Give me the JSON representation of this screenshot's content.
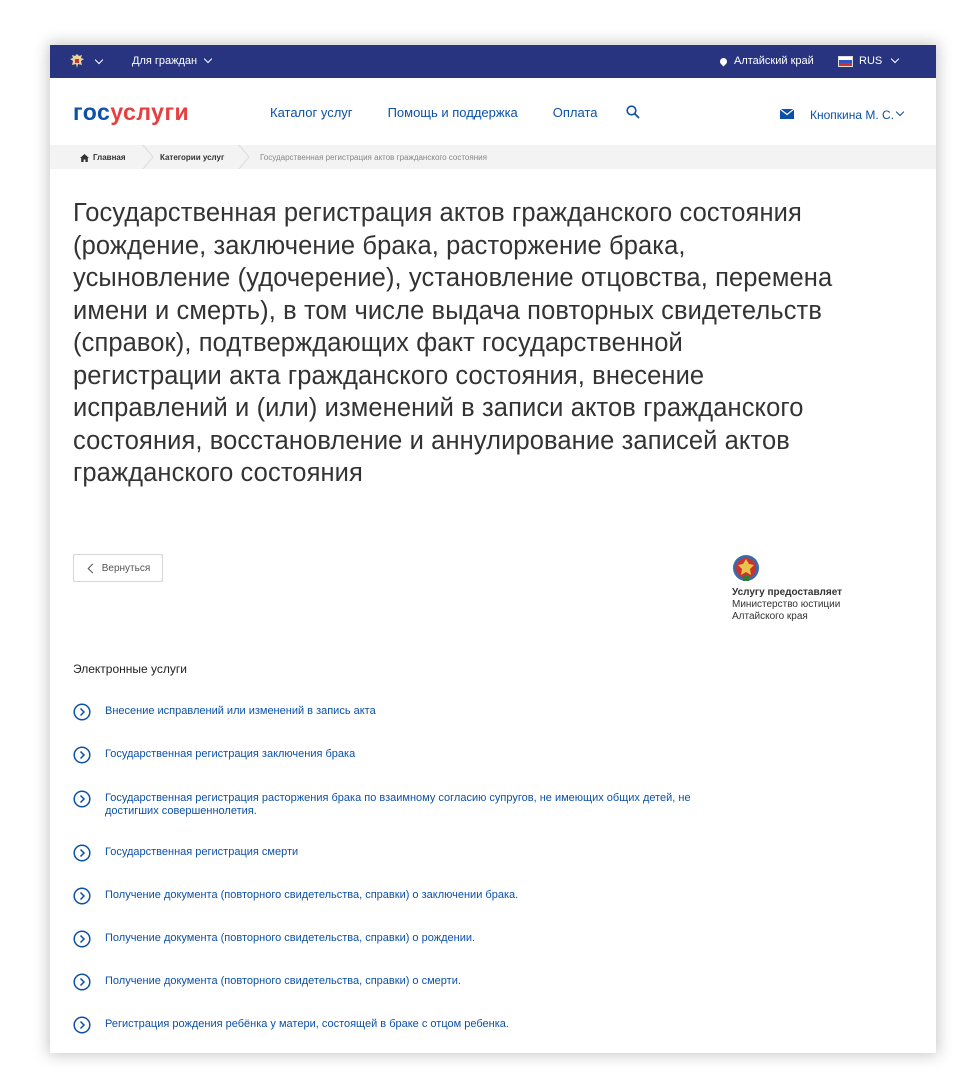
{
  "topbar": {
    "for_citizens": "Для граждан",
    "region": "Алтайский край",
    "lang": "RUS"
  },
  "header": {
    "logo_gos": "гос",
    "logo_uslugi": "услуги",
    "nav": [
      "Каталог услуг",
      "Помощь и поддержка",
      "Оплата"
    ],
    "user": "Кнопкина М. С."
  },
  "breadcrumb": {
    "home": "Главная",
    "category": "Категории услуг",
    "current": "Государственная регистрация актов гражданского состояния"
  },
  "main": {
    "title": "Государственная регистрация актов гражданского состояния (рождение, заключение брака, расторжение брака, усыновление (удочерение), установление отцовства, перемена имени и смерть), в том числе выдача повторных свидетельств (справок), подтверждающих факт государственной регистрации акта гражданского состояния, внесение исправлений и (или) изменений в записи актов гражданского состояния, восстановление и аннулирование записей актов гражданского состояния",
    "back": "Вернуться",
    "provider_label": "Услугу предоставляет",
    "provider_org": "Министерство юстиции Алтайского края",
    "section_title": "Электронные услуги",
    "services": [
      "Внесение исправлений или изменений в запись акта",
      "Государственная регистрация заключения брака",
      "Государственная регистрация расторжения брака по взаимному согласию супругов, не имеющих общих детей, не достигших совершеннолетия.",
      "Государственная регистрация смерти",
      "Получение документа (повторного свидетельства, справки) о заключении брака.",
      "Получение документа (повторного свидетельства, справки) о рождении.",
      "Получение документа (повторного свидетельства, справки) о смерти.",
      "Регистрация рождения ребёнка у матери, состоящей в браке с отцом ребенка."
    ]
  },
  "colors": {
    "topbar": "#28347f",
    "link": "#0c51a7",
    "logo_red": "#e63f3f"
  }
}
